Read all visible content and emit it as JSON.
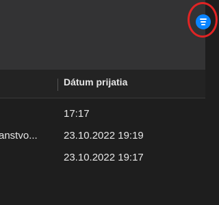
{
  "toolbar": {
    "filter_icon": "filter-lines-icon",
    "accent": "#0a84ff",
    "highlight_color": "#e02424"
  },
  "table": {
    "columns": [
      "Dátum prijatia"
    ],
    "rows": [
      {
        "subject": "",
        "date": "17:17"
      },
      {
        "subject": "anstvo...",
        "date": "23.10.2022 19:19"
      },
      {
        "subject": "",
        "date": "23.10.2022 19:17"
      }
    ]
  }
}
